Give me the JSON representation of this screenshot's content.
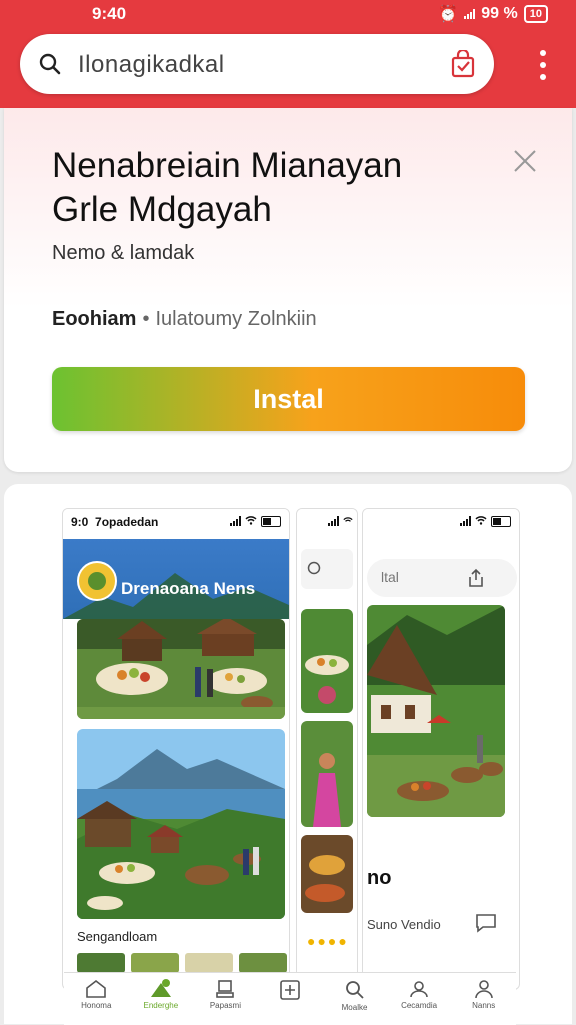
{
  "status_bar": {
    "time": "9:40",
    "battery": "99 %",
    "battery_icon_label": "10"
  },
  "search": {
    "query": "Ilonagikadkal",
    "menu_icon": "kebab-icon"
  },
  "app": {
    "title": "Nenabreiain Mianayan Grle Mdgayah",
    "subtitle": "Nemo & lamdak",
    "developer": "Eoohiam",
    "separator": "•",
    "category": "Iulatoumy Zolnkiin",
    "install_label": "Instal"
  },
  "screens": {
    "p1": {
      "time": "9:0",
      "app_name": "7opadedan",
      "banner_text": "Drenaoana Nens",
      "caption": "Sengandloam"
    },
    "p3": {
      "search_text": "ltal",
      "heading": "no",
      "subtext": "Suno Vendio"
    },
    "p2": {
      "dots": "●●●●"
    }
  },
  "bottom_nav": [
    {
      "label": "Honoma",
      "icon": "home-icon"
    },
    {
      "label": "Enderghe",
      "icon": "leaf-icon",
      "active": true
    },
    {
      "label": "Papasmi",
      "icon": "document-icon"
    },
    {
      "label": "",
      "icon": "add-icon"
    },
    {
      "label": "Moalke",
      "icon": "search-icon"
    },
    {
      "label": "Cecamdia",
      "icon": "people-icon"
    },
    {
      "label": "Nanns",
      "icon": "profile-icon"
    }
  ],
  "colors": {
    "header": "#e53a3f",
    "install_start": "#6cc231",
    "install_end": "#f78c0a"
  }
}
